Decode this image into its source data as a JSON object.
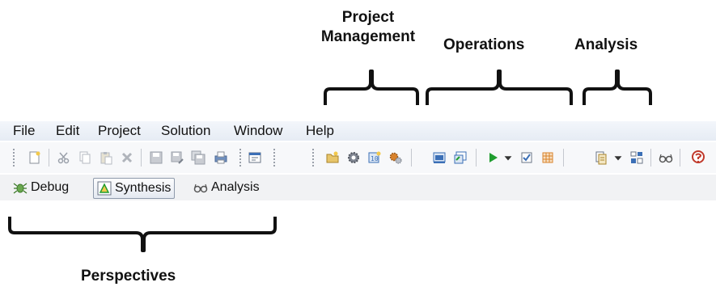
{
  "callouts": {
    "project_management": {
      "line1": "Project",
      "line2": "Management"
    },
    "operations": "Operations",
    "analysis": "Analysis",
    "perspectives": "Perspectives"
  },
  "menu": {
    "items": [
      "File",
      "Edit",
      "Project",
      "Solution",
      "Window",
      "Help"
    ]
  },
  "toolbar": {
    "icons": [
      "new-file-icon",
      "cut-icon",
      "copy-icon",
      "paste-icon",
      "delete-icon",
      "save-icon",
      "save-as-icon",
      "save-all-icon",
      "print-icon",
      "open-view-icon",
      "new-project-icon",
      "project-settings-icon",
      "new-solution-icon",
      "solution-settings-icon",
      "c-simulation-icon",
      "c-synthesis-icon",
      "run-icon",
      "run-dropdown-icon",
      "verify-icon",
      "export-rtl-icon",
      "open-report-icon",
      "report-dropdown-icon",
      "compare-reports-icon",
      "analysis-perspective-icon",
      "help-icon"
    ],
    "colors": {
      "run": "#1f9d2f",
      "accent_orange": "#d9822b",
      "accent_blue": "#3b6fb6"
    }
  },
  "perspectives": {
    "items": [
      {
        "label": "Debug",
        "icon": "debug-bug-icon"
      },
      {
        "label": "Synthesis",
        "icon": "synthesis-icon",
        "active": true
      },
      {
        "label": "Analysis",
        "icon": "analysis-glasses-icon"
      }
    ]
  }
}
